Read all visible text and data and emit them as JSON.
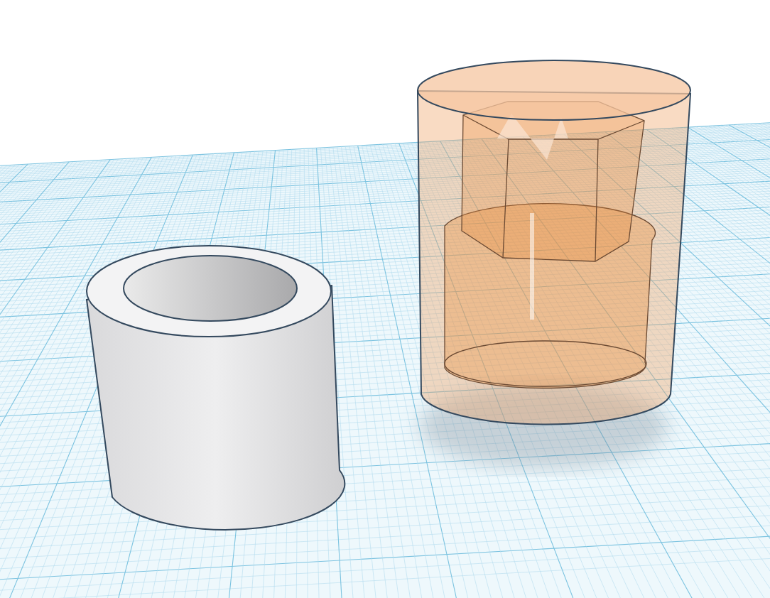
{
  "scene": {
    "workplane": {
      "kind": "grid"
    },
    "objects": [
      {
        "kind": "tube"
      },
      {
        "kind": "transparent-cylinder"
      }
    ]
  }
}
